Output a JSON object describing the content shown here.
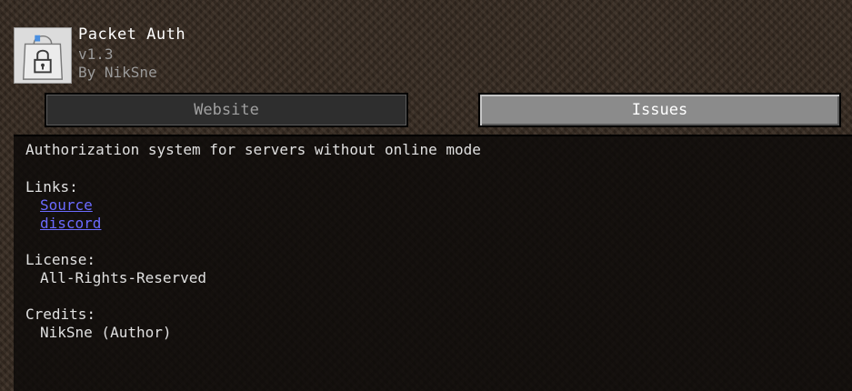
{
  "mod": {
    "title": "Packet Auth",
    "version": "v1.3",
    "author": "By NikSne",
    "icon": "lock-bag-icon"
  },
  "buttons": {
    "website": "Website",
    "issues": "Issues"
  },
  "details": {
    "description": "Authorization system for servers without online mode",
    "links_heading": "Links:",
    "links": [
      "Source",
      "discord"
    ],
    "license_heading": "License:",
    "license": "All-Rights-Reserved",
    "credits_heading": "Credits:",
    "credits": "NikSne (Author)"
  },
  "colors": {
    "link": "#6b6bff",
    "title": "#ffffff",
    "muted": "#9a9a9a"
  }
}
